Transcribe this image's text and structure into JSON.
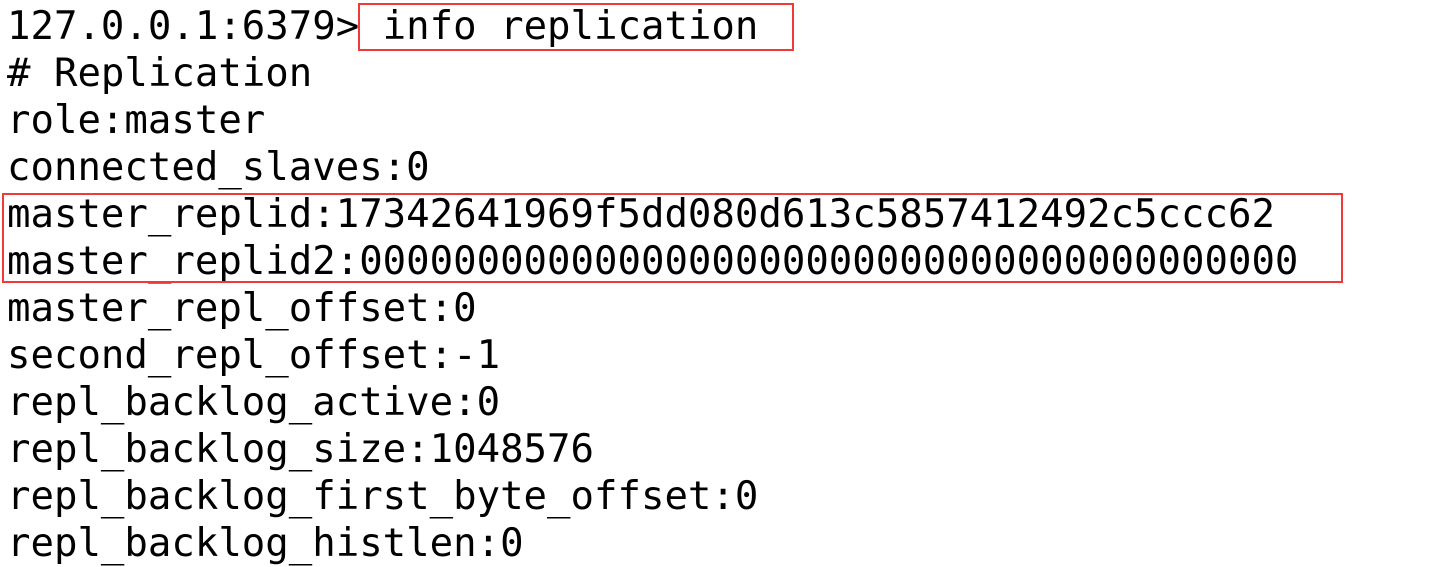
{
  "prompt": "127.0.0.1:6379>",
  "command": " info replication",
  "output": [
    "# Replication",
    "role:master",
    "connected_slaves:0",
    "master_replid:17342641969f5dd080d613c5857412492c5ccc62",
    "master_replid2:0000000000000000000000000000000000000000",
    "master_repl_offset:0",
    "second_repl_offset:-1",
    "repl_backlog_active:0",
    "repl_backlog_size:1048576",
    "repl_backlog_first_byte_offset:0",
    "repl_backlog_histlen:0"
  ],
  "highlight_color": "#f03a3a"
}
